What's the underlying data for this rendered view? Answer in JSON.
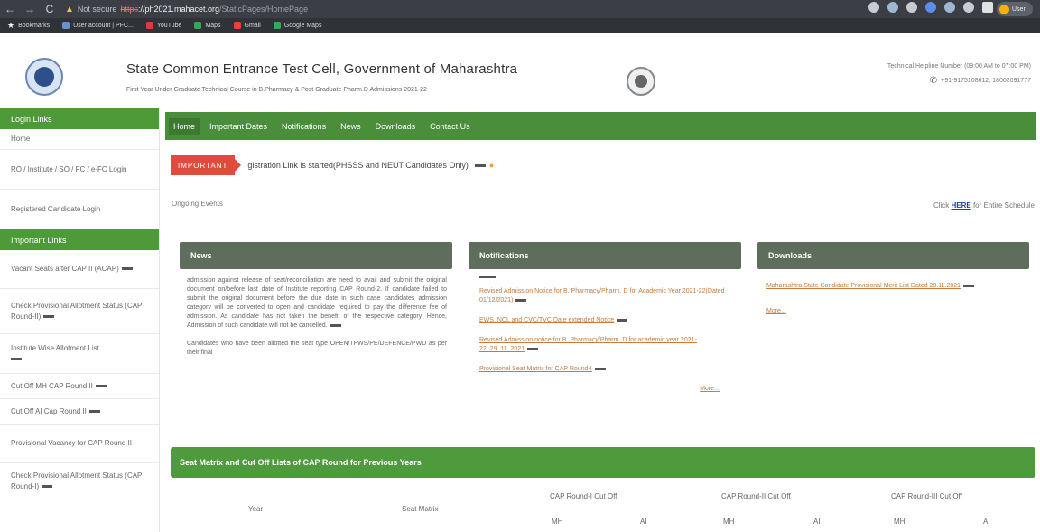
{
  "browser": {
    "nav": [
      "←",
      "→",
      "C"
    ],
    "insecure_label": "Not secure",
    "url_scheme": "https",
    "url_host": "://ph2021.mahacet.org",
    "url_path": "/StaticPages/HomePage",
    "profile_label": "User"
  },
  "bookmarks": [
    {
      "icon": "bookmarks-star-icon",
      "label": "Bookmarks"
    },
    {
      "icon": "user-account-icon",
      "label": "User account | PFC..."
    },
    {
      "icon": "youtube-icon",
      "label": "YouTube"
    },
    {
      "icon": "maps-icon",
      "label": "Maps"
    },
    {
      "icon": "gmail-icon",
      "label": "Gmail"
    },
    {
      "icon": "google-maps-icon",
      "label": "Google Maps"
    }
  ],
  "header": {
    "title": "State Common Entrance Test Cell, Government of Maharashtra",
    "subtitle": "First Year Under Graduate Technical Course in B.Pharmacy & Post Graduate Pharm.D Admissions 2021-22",
    "helpline": "Technical Helpline Number (09:00 AM to 07:00 PM)",
    "phones": "+91-9175108612, 18002091777"
  },
  "sidebar": {
    "login_head": "Login Links",
    "login_items": [
      "Home",
      "RO / Institute / SO / FC / e-FC Login",
      "Registered Candidate Login"
    ],
    "important_head": "Important Links",
    "important_items": [
      "Vacant Seats after CAP II (ACAP)",
      "Check Provisional Allotment Status (CAP Round-II)",
      "Institute Wise Allotment List",
      "Cut Off MH CAP Round II",
      "Cut Off AI Cap Round II",
      "Provisional Vacancy for CAP Round II",
      "Check Provisional Allotment Status (CAP Round-I)"
    ]
  },
  "nav": [
    "Home",
    "Important Dates",
    "Notifications",
    "News",
    "Downloads",
    "Contact Us"
  ],
  "important": {
    "badge": "IMPORTANT",
    "text": "gistration Link is started(PHSSS and NEUT Candidates Only)"
  },
  "ongoing_label": "Ongoing Events",
  "schedule": {
    "prefix": "Click ",
    "link": "HERE",
    "suffix": " for Entire Schedule"
  },
  "panels": {
    "news": {
      "title": "News",
      "p1": "admission against release of seat/reconciliation are need to avail and submit the original document on/before last date of Institute reporting CAP Round-2. If candidate failed to submit the original document before the due date in such case candidates admission category will be converted to open and candidate required to pay the difference fee of admission. As candidate has not taken the benefit of the respective category. Hence, Admission of such candidate will not be cancelled.",
      "p2": "Candidates who have been allotted the seat type OPEN/TFWS/PE/DEFENCE/PWD as per their final"
    },
    "notifications": {
      "title": "Notifications",
      "items": [
        "Revised Admission Notice for B. Pharmacy/Pharm. D for Academic Year 2021-22(Dated 01/12/2021)",
        "EWS, NCL and CVC/TVC Date extended Notice",
        "Revised Admission notice for B. Pharmacy/Pharm. D for academic year 2021-22_29_11_2021",
        "Provisional Seat Matrix for CAP Round-I"
      ],
      "more": "More..."
    },
    "downloads": {
      "title": "Downloads",
      "items": [
        "Maharashtra State Candidate Provisional Merit List Dated 28.11.2021"
      ],
      "more": "More..."
    }
  },
  "seat_matrix": {
    "title": "Seat Matrix and Cut Off Lists of CAP Round for Previous Years",
    "col_year": "Year",
    "col_seat": "Seat Matrix",
    "cap1": "CAP Round-I Cut Off",
    "cap2": "CAP Round-II Cut Off",
    "cap3": "CAP Round-III Cut Off",
    "mh": "MH",
    "ai": "AI"
  }
}
